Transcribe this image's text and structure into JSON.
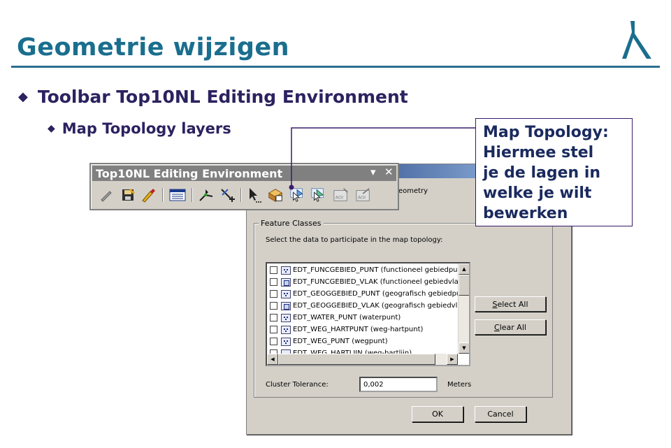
{
  "slide": {
    "title": "Geometrie wijzigen",
    "bullet1": "Toolbar Top10NL Editing Environment",
    "bullet2": "Map Topology layers"
  },
  "callout": {
    "lines": [
      "Map Topology:",
      "Hiermee stel",
      "je de lagen in",
      "welke je wilt",
      "bewerken"
    ]
  },
  "toolbar": {
    "title": "Top10NL Editing Environment",
    "minimize_glyph": "▾",
    "close_glyph": "✕",
    "icons": [
      "edit-pencil-icon",
      "save-edits-icon",
      "sketch-tool-icon",
      "attributes-icon",
      "topology-edit-icon",
      "add-vertex-icon",
      "select-pointer-icon",
      "map-topology-icon",
      "select-features-icon",
      "select-features-alt-icon",
      "aoi-icon",
      "aoi-edit-icon"
    ]
  },
  "dialog": {
    "description_fragment": "ent geometry",
    "group_label": "Feature Classes",
    "select_prompt": "Select the data to participate in the map topology:",
    "feature_classes": [
      {
        "name": "EDT_FUNCGEBIED_PUNT (functioneel gebiedpun",
        "type": "point",
        "checked": false
      },
      {
        "name": "EDT_FUNCGEBIED_VLAK (functioneel gebiedvlak",
        "type": "polygon",
        "checked": false
      },
      {
        "name": "EDT_GEOGGEBIED_PUNT (geografisch gebiedpu",
        "type": "point",
        "checked": false
      },
      {
        "name": "EDT_GEOGGEBIED_VLAK (geografisch gebiedvlal",
        "type": "polygon",
        "checked": false
      },
      {
        "name": "EDT_WATER_PUNT (waterpunt)",
        "type": "point",
        "checked": false
      },
      {
        "name": "EDT_WEG_HARTPUNT (weg-hartpunt)",
        "type": "point",
        "checked": false
      },
      {
        "name": "EDT_WEG_PUNT (wegpunt)",
        "type": "point",
        "checked": false
      },
      {
        "name": "EDT_WEG_HARTLIJN (weg-hartlijn)",
        "type": "line",
        "checked": false
      }
    ],
    "select_all_first": "S",
    "select_all_rest": "elect All",
    "clear_all_first": "C",
    "clear_all_rest": "lear All",
    "cluster_label": "Cluster Tolerance:",
    "cluster_value": "0,002",
    "cluster_unit": "Meters",
    "ok_label": "OK",
    "cancel_label": "Cancel",
    "scroll_up": "▲",
    "scroll_down": "▼",
    "scroll_left": "◀",
    "scroll_right": "▶"
  }
}
